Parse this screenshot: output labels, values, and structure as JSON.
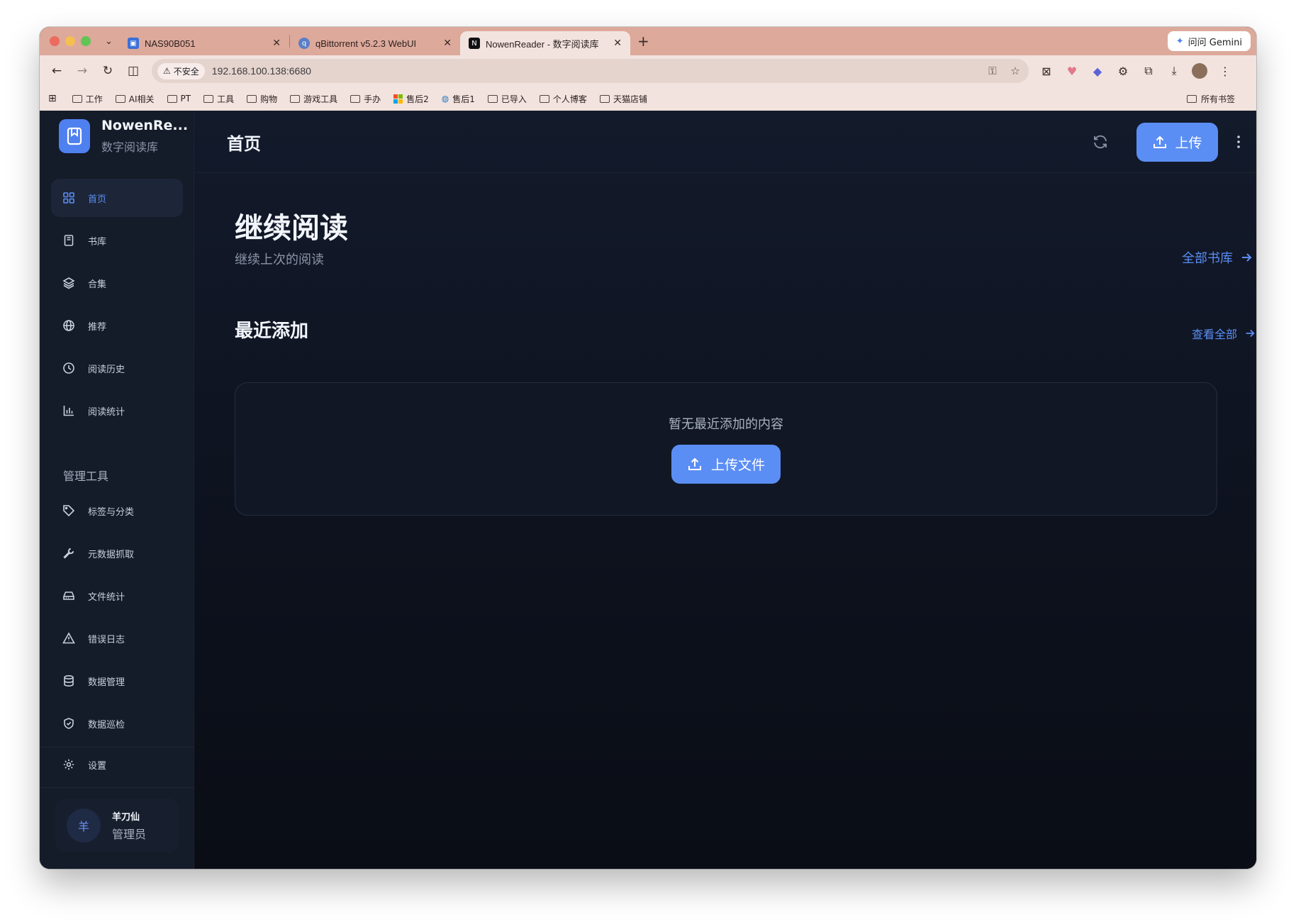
{
  "browser": {
    "tabs": [
      {
        "title": "NAS90B051",
        "favicon_color": "#3b6fd8",
        "active": false
      },
      {
        "title": "qBittorrent v5.2.3 WebUI",
        "favicon_color": "#5a7fc6",
        "active": false
      },
      {
        "title": "NowenReader - 数字阅读库",
        "favicon_color": "#111111",
        "favicon_glyph": "N",
        "active": true
      }
    ],
    "gemini_label": "问问 Gemini",
    "security_label": "不安全",
    "url": "192.168.100.138:6680",
    "bookmarks": [
      "工作",
      "AI相关",
      "PT",
      "工具",
      "购物",
      "游戏工具",
      "手办",
      "售后2",
      "售后1",
      "已导入",
      "个人博客",
      "天猫店铺"
    ],
    "all_bookmarks_label": "所有书签"
  },
  "sidebar": {
    "brand_name": "NowenRe...",
    "brand_subtitle": "数字阅读库",
    "nav_items": [
      {
        "label": "首页",
        "icon": "grid-icon"
      },
      {
        "label": "书库",
        "icon": "book-icon"
      },
      {
        "label": "合集",
        "icon": "layers-icon"
      },
      {
        "label": "推荐",
        "icon": "globe-icon"
      },
      {
        "label": "阅读历史",
        "icon": "clock-icon"
      },
      {
        "label": "阅读统计",
        "icon": "bar-chart-icon"
      }
    ],
    "admin_section_title": "管理工具",
    "admin_items": [
      {
        "label": "标签与分类",
        "icon": "tag-icon"
      },
      {
        "label": "元数据抓取",
        "icon": "wrench-icon"
      },
      {
        "label": "文件统计",
        "icon": "hard-drive-icon"
      },
      {
        "label": "错误日志",
        "icon": "warning-icon"
      },
      {
        "label": "数据管理",
        "icon": "database-icon"
      },
      {
        "label": "数据巡检",
        "icon": "shield-check-icon"
      }
    ],
    "settings_label": "设置",
    "user": {
      "avatar_char": "羊",
      "name": "羊刀仙",
      "role": "管理员"
    }
  },
  "header": {
    "title": "首页",
    "upload_label": "上传"
  },
  "continue_reading": {
    "title": "继续阅读",
    "subtitle": "继续上次的阅读",
    "all_library_link": "全部书库"
  },
  "recently_added": {
    "title": "最近添加",
    "view_all_link": "查看全部",
    "empty_text": "暂无最近添加的内容",
    "upload_file_label": "上传文件"
  },
  "colors": {
    "accent": "#5b8ef5",
    "sidebar_bg": "#141b29",
    "tab_bar": "#dca99b"
  }
}
